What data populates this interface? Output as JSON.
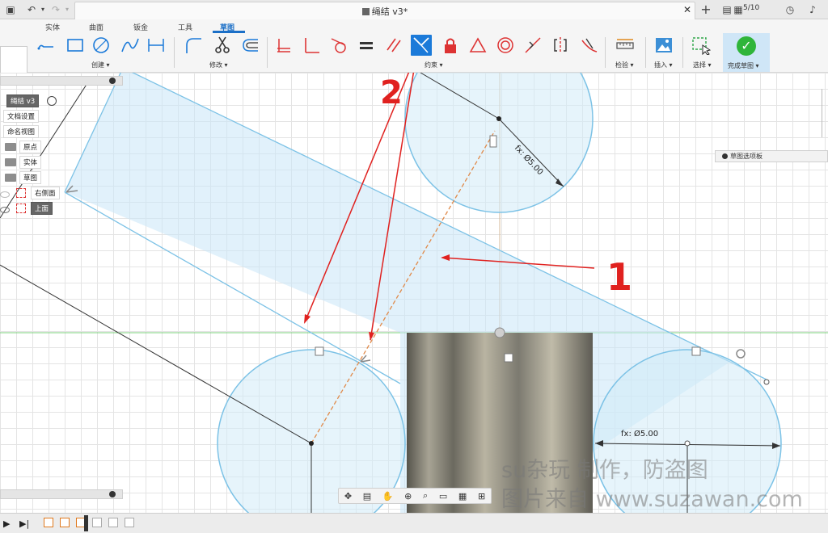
{
  "window": {
    "doc_title": "绳结 v3*",
    "version_badge": "5/10"
  },
  "ribbon": {
    "tabs": [
      "实体",
      "曲面",
      "钣金",
      "工具",
      "草图"
    ],
    "active_tab": "草图",
    "groups": {
      "create": "创建 ▾",
      "modify": "修改 ▾",
      "constraints": "约束 ▾",
      "inspect": "检验 ▾",
      "insert": "插入 ▾",
      "select": "选择 ▾",
      "finish": "完成草图 ▾"
    },
    "colors": {
      "accent": "#1b6fc7",
      "finish_green": "#2fb53a"
    }
  },
  "browser": {
    "root": "绳结 v3",
    "items": [
      "文档设置",
      "命名视图",
      "原点",
      "实体",
      "草图"
    ],
    "sketches": [
      "右侧面",
      "上面"
    ]
  },
  "sketch_palette": {
    "label": "草图选项板"
  },
  "canvas": {
    "dim_top": "fx: Ø5.00",
    "dim_right": "fx: Ø5.00",
    "annotation_1": "1",
    "annotation_2": "2"
  },
  "watermark": {
    "line1": "su杂玩 制作，防盗图",
    "line2": "图片来自 www.suzawan.com"
  }
}
